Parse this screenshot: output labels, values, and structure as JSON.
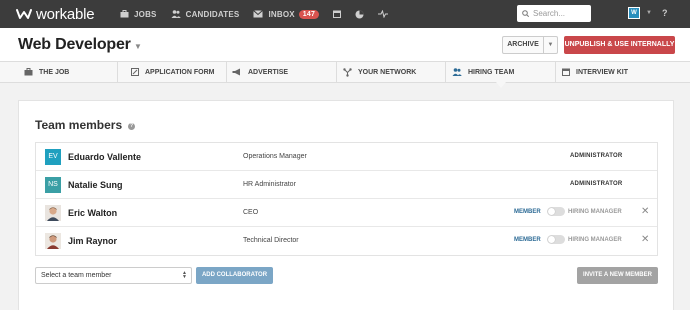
{
  "topnav": {
    "brand": "workable",
    "items": [
      {
        "label": "JOBS",
        "icon": "briefcase-icon"
      },
      {
        "label": "CANDIDATES",
        "icon": "people-icon"
      },
      {
        "label": "INBOX",
        "icon": "envelope-icon",
        "badge": "147"
      }
    ],
    "icons": [
      "calendar-icon",
      "pie-chart-icon",
      "activity-icon"
    ],
    "search_placeholder": "Search...",
    "user_initials": "W",
    "help": "?"
  },
  "header": {
    "job_title": "Web Developer",
    "archive_label": "ARCHIVE",
    "unpublish_label": "UNPUBLISH & USE INTERNALLY"
  },
  "tabs": [
    {
      "label": "THE JOB",
      "icon": "briefcase-icon"
    },
    {
      "label": "APPLICATION FORM",
      "icon": "edit-icon"
    },
    {
      "label": "ADVERTISE",
      "icon": "megaphone-icon"
    },
    {
      "label": "YOUR NETWORK",
      "icon": "network-icon"
    },
    {
      "label": "HIRING TEAM",
      "icon": "people-icon",
      "active": true
    },
    {
      "label": "INTERVIEW KIT",
      "icon": "calendar-icon"
    }
  ],
  "main": {
    "section_title": "Team members",
    "members": [
      {
        "initials": "EV",
        "avatar_color": "#1fa0bf",
        "name": "Eduardo Vallente",
        "role": "Operations Manager",
        "permission": "ADMINISTRATOR"
      },
      {
        "initials": "NS",
        "avatar_color": "#3a9fa5",
        "name": "Natalie Sung",
        "role": "HR Administrator",
        "permission": "ADMINISTRATOR"
      },
      {
        "photo": "person-photo",
        "name": "Eric Walton",
        "role": "CEO",
        "member_label": "MEMBER",
        "hiring_manager_label": "HIRING MANAGER",
        "hiring_manager": false
      },
      {
        "photo": "person-photo",
        "name": "Jim Raynor",
        "role": "Technical Director",
        "member_label": "MEMBER",
        "hiring_manager_label": "HIRING MANAGER",
        "hiring_manager": false
      }
    ],
    "select_placeholder": "Select a team member",
    "add_collaborator_label": "ADD COLLABORATOR",
    "invite_label": "INVITE A NEW MEMBER"
  },
  "colors": {
    "topbar": "#3c3c3c",
    "danger": "#c9474a",
    "primary_muted": "#7ba6c6",
    "member_blue": "#2d6b96"
  }
}
